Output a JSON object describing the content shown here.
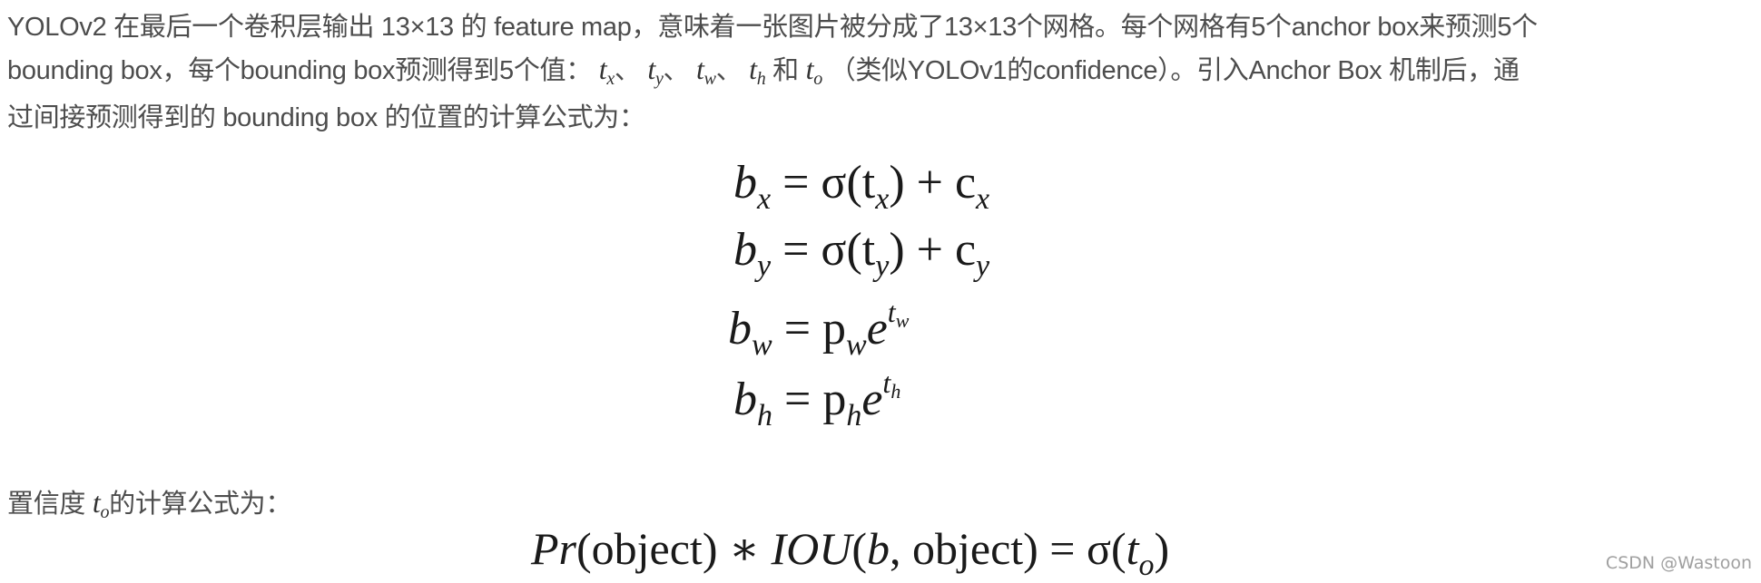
{
  "paragraph1": {
    "line1": "YOLOv2 在最后一个卷积层输出 13×13 的 feature map，意味着一张图片被分成了13×13个网格。每个网格有5个anchor box来预测5个",
    "line2_prefix": "bounding box，每个bounding box预测得到5个值：",
    "vars": [
      "t",
      "x",
      "t",
      "y",
      "t",
      "w",
      "t",
      "h",
      "t",
      "o"
    ],
    "sep": "、",
    "and": " 和 ",
    "line2_suffix": "（类似YOLOv1的confidence）。引入Anchor Box 机制后，通",
    "line3": "过间接预测得到的 bounding box 的位置的计算公式为："
  },
  "formulas": {
    "bx": {
      "lhs": "b",
      "lhs_sub": "x",
      "rhs": "= σ(t",
      "rhs_sub": "x",
      "rhs_end": ") + c",
      "end_sub": "x"
    },
    "by": {
      "lhs": "b",
      "lhs_sub": "y",
      "rhs": "= σ(t",
      "rhs_sub": "y",
      "rhs_end": ") + c",
      "end_sub": "y"
    },
    "bw": {
      "lhs": "b",
      "lhs_sub": "w",
      "rhs": "= p",
      "rhs_sub": "w",
      "exp_base": "e",
      "exp": "t",
      "exp_sub": "w"
    },
    "bh": {
      "lhs": "b",
      "lhs_sub": "h",
      "rhs": "= p",
      "rhs_sub": "h",
      "exp_base": "e",
      "exp": "t",
      "exp_sub": "h"
    }
  },
  "paragraph2": {
    "prefix": "置信度 ",
    "var": "t",
    "var_sub": "o",
    "suffix": "的计算公式为："
  },
  "confidence_formula": {
    "pr": "Pr",
    "part1": "(object) ∗ ",
    "iou": "IOU",
    "part2": "(",
    "b": "b",
    "part3": ", object) = σ(",
    "t": "t",
    "t_sub": "o",
    "part4": ")"
  },
  "watermark": "CSDN @Wastoon"
}
